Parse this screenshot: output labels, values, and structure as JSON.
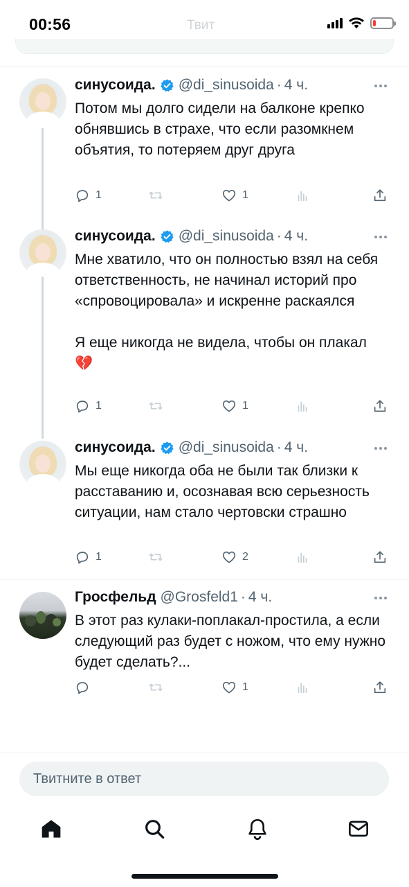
{
  "status_bar": {
    "time": "00:56",
    "faded_title": "Твит",
    "battery_level": 0.15,
    "battery_color": "#ff3b30"
  },
  "tweets": [
    {
      "display_name": "синусоида.",
      "verified": true,
      "handle": "@di_sinusoida",
      "separator": "·",
      "time": "4 ч.",
      "text": "Потом мы долго сидели на балконе крепко обнявшись в страхе, что если разомкнем объятия, то потеряем друг друга",
      "replies": "1",
      "retweets": "",
      "likes": "1",
      "views": ""
    },
    {
      "display_name": "синусоида.",
      "verified": true,
      "handle": "@di_sinusoida",
      "separator": "·",
      "time": "4 ч.",
      "text": "Мне хватило, что он полностью взял на себя ответственность, не начинал историй про «спровоцировала» и искренне раскаялся\n\nЯ еще никогда не видела, чтобы он плакал 💔",
      "replies": "1",
      "retweets": "",
      "likes": "1",
      "views": ""
    },
    {
      "display_name": "синусоида.",
      "verified": true,
      "handle": "@di_sinusoida",
      "separator": "·",
      "time": "4 ч.",
      "text": "Мы еще никогда оба не были так близки к расставанию и, осознавая всю серьезность ситуации, нам стало чертовски страшно",
      "replies": "1",
      "retweets": "",
      "likes": "2",
      "views": ""
    },
    {
      "display_name": "Гросфельд",
      "verified": false,
      "handle": "@Grosfeld1",
      "separator": "·",
      "time": "4 ч.",
      "text": "В этот раз кулаки-поплакал-простила, а если следующий раз будет с ножом, что ему нужно будет сделать?...",
      "replies": "",
      "retweets": "",
      "likes": "1",
      "views": ""
    }
  ],
  "reply_box": {
    "placeholder": "Твитните в ответ"
  },
  "bottom_nav": {
    "items": [
      "home-icon",
      "search-icon",
      "notifications-icon",
      "messages-icon"
    ]
  },
  "colors": {
    "verified": "#1d9bf0",
    "text": "#0f1419",
    "muted": "#536471",
    "divider": "#eff3f4"
  }
}
